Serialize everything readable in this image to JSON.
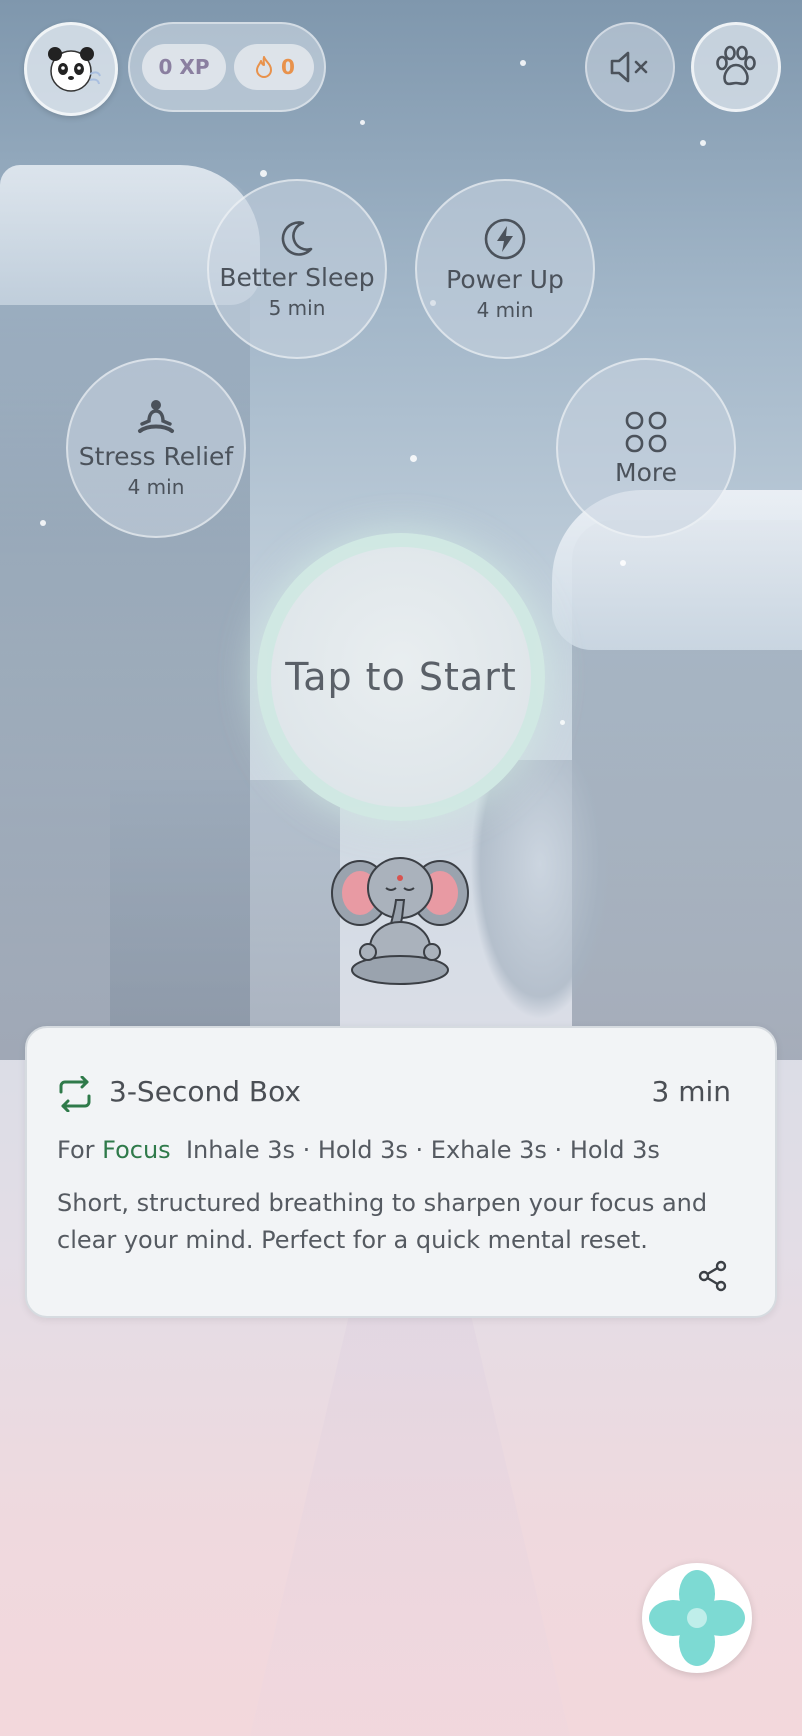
{
  "header": {
    "xp_label": "0 XP",
    "streak_count": "0"
  },
  "exercises": [
    {
      "label": "Better Sleep",
      "duration": "5 min",
      "icon": "moon-icon"
    },
    {
      "label": "Power Up",
      "duration": "4 min",
      "icon": "lightning-icon"
    },
    {
      "label": "Stress Relief",
      "duration": "4 min",
      "icon": "meditation-icon"
    },
    {
      "label": "More",
      "icon": "grid-icon"
    }
  ],
  "start_label": "Tap to Start",
  "card": {
    "title": "3-Second Box",
    "duration": "3 min",
    "for_prefix": "For",
    "for_tag": "Focus",
    "pattern": "Inhale 3s · Hold 3s · Exhale 3s · Hold 3s",
    "description": "Short, structured breathing to sharpen your focus and clear your mind. Perfect for a quick mental reset."
  },
  "colors": {
    "accent_green": "#2f7a4a",
    "fire_orange": "#e8924c",
    "xp_purple": "#8a7fa0",
    "fab_teal": "#5fd3cc"
  }
}
